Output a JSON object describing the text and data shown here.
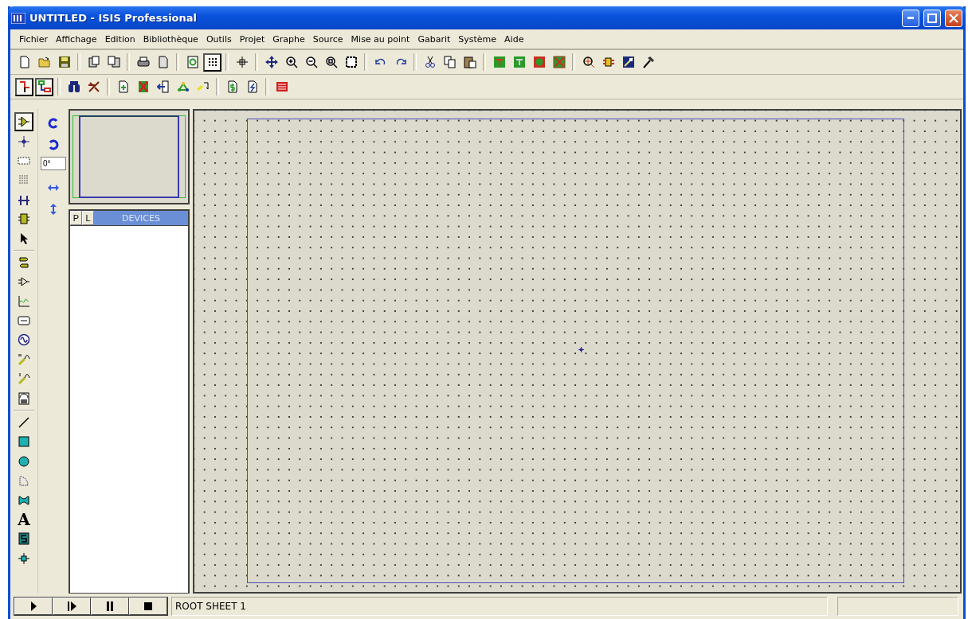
{
  "window": {
    "title": "UNTITLED - ISIS Professional"
  },
  "menu": [
    "Fichier",
    "Affichage",
    "Edition",
    "Bibliothèque",
    "Outils",
    "Projet",
    "Graphe",
    "Source",
    "Mise au point",
    "Gabarit",
    "Système",
    "Aide"
  ],
  "toolbar_pressed": {
    "grid": true,
    "wire_autorouter": true,
    "property_assign": true
  },
  "left_tools": [
    {
      "kind": "component",
      "selected": true
    },
    {
      "kind": "junction",
      "selected": false
    },
    {
      "kind": "label",
      "selected": false
    },
    {
      "kind": "script",
      "selected": false
    },
    {
      "kind": "bus",
      "selected": false
    },
    {
      "kind": "subcircuit",
      "selected": false
    },
    {
      "kind": "pointer",
      "selected": false
    },
    {
      "kind": "separator"
    },
    {
      "kind": "terminal",
      "selected": false
    },
    {
      "kind": "pin",
      "selected": false
    },
    {
      "kind": "graph",
      "selected": false
    },
    {
      "kind": "tape",
      "selected": false
    },
    {
      "kind": "generator",
      "selected": false
    },
    {
      "kind": "voltage_probe",
      "selected": false
    },
    {
      "kind": "current_probe",
      "selected": false
    },
    {
      "kind": "instrument",
      "selected": false
    },
    {
      "kind": "separator"
    },
    {
      "kind": "line",
      "selected": false
    },
    {
      "kind": "box",
      "selected": false
    },
    {
      "kind": "circle",
      "selected": false
    },
    {
      "kind": "arc",
      "selected": false
    },
    {
      "kind": "path",
      "selected": false
    },
    {
      "kind": "text",
      "glyph": "A",
      "selected": false
    },
    {
      "kind": "symbol",
      "selected": false
    },
    {
      "kind": "marker",
      "selected": false
    }
  ],
  "rotation": {
    "value": "0°"
  },
  "device_panel": {
    "tabs": [
      {
        "label": "P",
        "selected": false
      },
      {
        "label": "L",
        "selected": false
      }
    ],
    "title": "DEVICES"
  },
  "status_bar": {
    "sheet": "ROOT SHEET 1"
  }
}
